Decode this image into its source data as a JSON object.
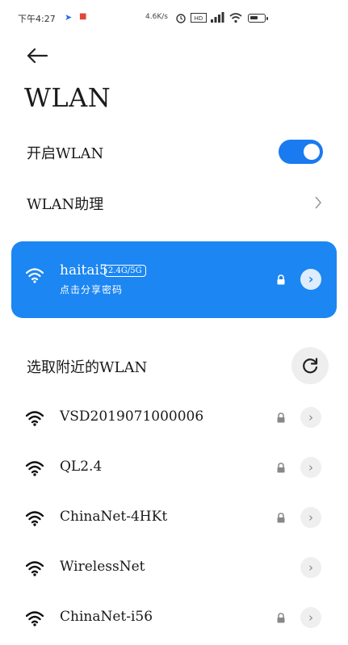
{
  "status_bar": {
    "time": "下午4:27",
    "speed": "4.6K/s",
    "icons": [
      "send-icon",
      "app-notification-icon",
      "alarm-icon",
      "volte-icon",
      "signal-icon",
      "wifi-icon",
      "battery-icon"
    ]
  },
  "header": {
    "back_icon": "back-arrow-icon",
    "title": "WLAN"
  },
  "wlan_toggle": {
    "label": "开启WLAN",
    "on": true
  },
  "assistant": {
    "label": "WLAN助理"
  },
  "connected": {
    "ssid": "haitai5",
    "band": "2.4G/5G",
    "subtitle": "点击分享密码"
  },
  "nearby": {
    "label": "选取附近的WLAN",
    "networks": [
      {
        "name": "VSD2019071000006",
        "locked": true
      },
      {
        "name": "QL2.4",
        "locked": true
      },
      {
        "name": "ChinaNet-4HKt",
        "locked": true
      },
      {
        "name": "WirelessNet",
        "locked": false
      },
      {
        "name": "ChinaNet-i56",
        "locked": true
      }
    ]
  },
  "colors": {
    "accent": "#1c86f2",
    "toggle": "#1a7af0"
  }
}
